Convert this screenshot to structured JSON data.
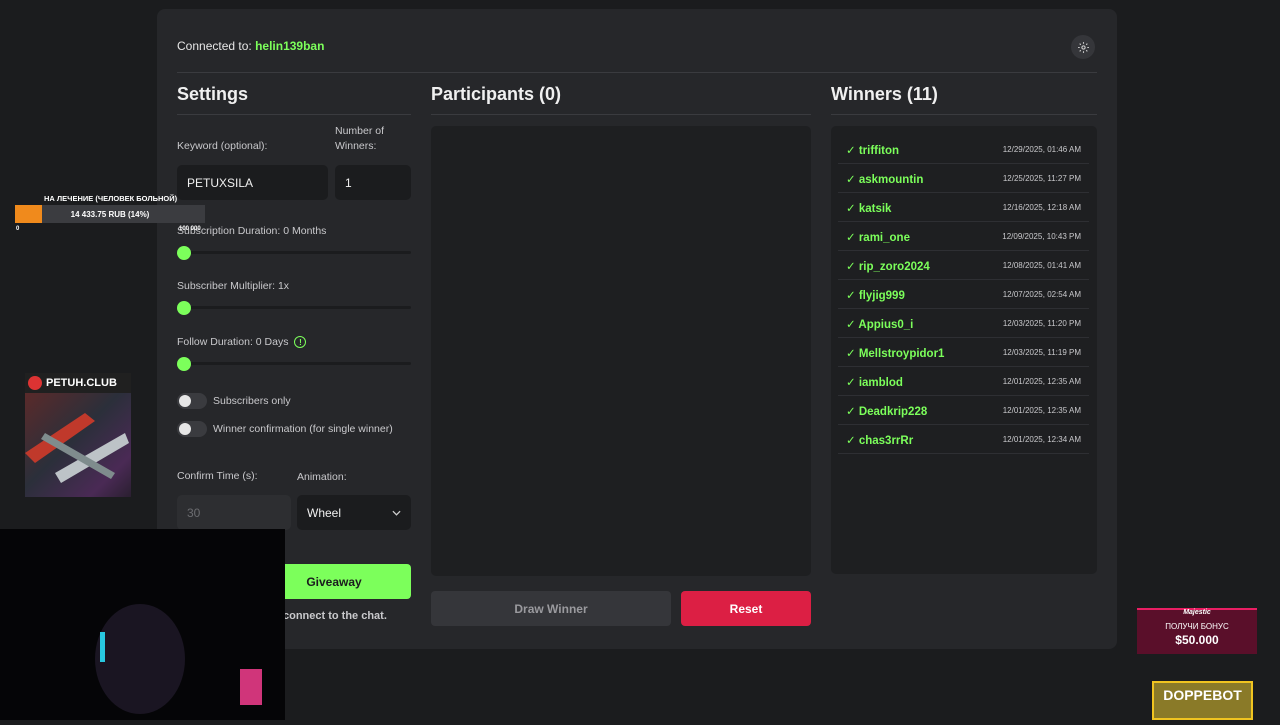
{
  "header": {
    "connected_label": "Connected to:",
    "username": "helin139ban"
  },
  "settings": {
    "title": "Settings",
    "keyword_label": "Keyword (optional):",
    "keyword_value": "PETUXSILA",
    "winners_label": "Number of Winners:",
    "winners_value": "1",
    "sub_duration_label": "Subscription Duration: 0 Months",
    "sub_multiplier_label": "Subscriber Multiplier: 1x",
    "follow_duration_label": "Follow Duration: 0 Days",
    "subs_only_label": "Subscribers only",
    "winner_confirm_label": "Winner confirmation (for single winner)",
    "confirm_time_label": "Confirm Time (s):",
    "confirm_time_value": "30",
    "animation_label": "Animation:",
    "animation_value": "Wheel",
    "start_button": "Giveaway",
    "status_text": "connect to the chat."
  },
  "participants": {
    "title": "Participants (0)",
    "draw_button": "Draw Winner",
    "reset_button": "Reset"
  },
  "winners": {
    "title": "Winners (11)",
    "list": [
      {
        "name": "✓ triffiton",
        "date": "12/29/2025, 01:46 AM"
      },
      {
        "name": "✓ askmountin",
        "date": "12/25/2025, 11:27 PM"
      },
      {
        "name": "✓ katsik",
        "date": "12/16/2025, 12:18 AM"
      },
      {
        "name": "✓ rami_one",
        "date": "12/09/2025, 10:43 PM"
      },
      {
        "name": "✓ rip_zoro2024",
        "date": "12/08/2025, 01:41 AM"
      },
      {
        "name": "✓ flyjig999",
        "date": "12/07/2025, 02:54 AM"
      },
      {
        "name": "✓ Appius0_i",
        "date": "12/03/2025, 11:20 PM"
      },
      {
        "name": "✓ Mellstroypidor1",
        "date": "12/03/2025, 11:19 PM"
      },
      {
        "name": "✓ iamblod",
        "date": "12/01/2025, 12:35 AM"
      },
      {
        "name": "✓ Deadkrip228",
        "date": "12/01/2025, 12:35 AM"
      },
      {
        "name": "✓ chas3rrRr",
        "date": "12/01/2025, 12:34 AM"
      }
    ]
  },
  "overlay": {
    "donation_title": "НА ЛЕЧЕНИЕ (ЧЕЛОВЕК БОЛЬНОЙ)",
    "donation_amount": "14 433.75 RUB (14%)",
    "donation_progress": 0.14,
    "donation_min": "0",
    "donation_max": "100 000",
    "petuh_label": "PETUH.CLUB",
    "ad_brand": "Majestic",
    "ad_text": "ПОЛУЧИ БОНУС",
    "ad_amount": "$50.000",
    "ad2_text": "DOPPEBOT"
  },
  "colors": {
    "accent": "#7cff5b",
    "danger": "#dc1f44",
    "panel": "#26272a",
    "bg": "#1b1c1e"
  }
}
